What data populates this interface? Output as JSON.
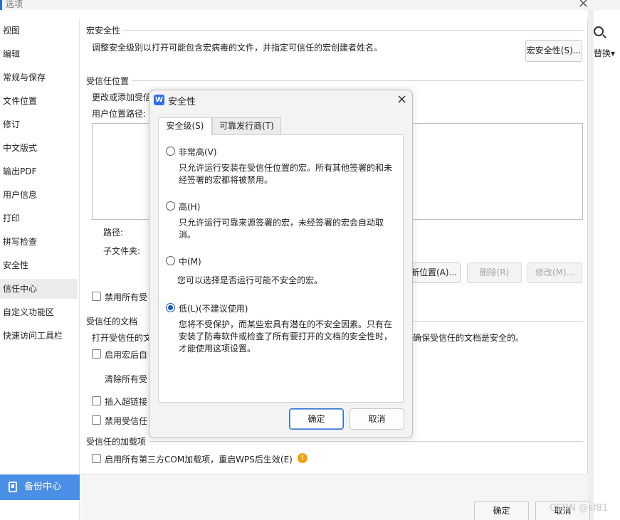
{
  "window": {
    "title": "选项",
    "close_glyph": "×"
  },
  "sidebar": {
    "items": [
      {
        "label": "视图"
      },
      {
        "label": "编辑"
      },
      {
        "label": "常规与保存"
      },
      {
        "label": "文件位置"
      },
      {
        "label": "修订"
      },
      {
        "label": "中文版式"
      },
      {
        "label": "输出PDF"
      },
      {
        "label": "用户信息"
      },
      {
        "label": "打印"
      },
      {
        "label": "拼写检查"
      },
      {
        "label": "安全性"
      },
      {
        "label": "信任中心"
      },
      {
        "label": "自定义功能区"
      },
      {
        "label": "快速访问工具栏"
      }
    ],
    "active_index": 11,
    "backup_label": "备份中心"
  },
  "right_edge": {
    "replace_label": "替换▾"
  },
  "macro_security": {
    "title": "宏安全性",
    "description": "调整安全级别以打开可能包含宏病毒的文件，并指定可信任的宏创建者姓名。",
    "button_label": "宏安全性(S)..."
  },
  "trusted_locations": {
    "title": "受信任位置",
    "description_partial": "更改或添加受信",
    "user_path_label": "用户位置路径:",
    "path_label": "路径:",
    "subfolder_label": "子文件夹:",
    "add_button_partial": "新位置(A)...",
    "delete_button": "删除(R)",
    "modify_button": "修改(M)...",
    "disable_all_partial": "禁用所有受"
  },
  "trusted_documents": {
    "title": "受信任的文档",
    "description_left": "打开受信任的文",
    "description_right": "确保受信任的文档是安全的。",
    "enable_macro_partial": "启用宏后自",
    "clear_partial": "清除所有受",
    "insert_hyperlink_partial": "插入超链接",
    "disable_trusted_partial": "禁用受信任"
  },
  "trusted_addins": {
    "title": "受信任的加载项",
    "enable_com_label": "启用所有第三方COM加载项，重启WPS后生效(E)",
    "warn_glyph": "!"
  },
  "bottom": {
    "ok_label": "确定",
    "cancel_label": "取消"
  },
  "dialog": {
    "logo_glyph": "W",
    "title": "安全性",
    "close_glyph": "×",
    "tabs": [
      {
        "label": "安全级(S)"
      },
      {
        "label": "可靠发行商(T)"
      }
    ],
    "active_tab": 0,
    "options": [
      {
        "label": "非常高(V)",
        "desc1": "只允许运行安装在受信任位置的宏。所有其他签署的和未",
        "desc2": "经签署的宏都将被禁用。"
      },
      {
        "label": "高(H)",
        "desc1": "只允许运行可靠来源签署的宏，未经签署的宏会自动取",
        "desc2": "消。"
      },
      {
        "label": "中(M)",
        "desc1": "您可以选择是否运行可能不安全的宏。",
        "desc2": ""
      },
      {
        "label": "低(L)(不建议使用)",
        "desc1": "您将不受保护，而某些宏具有潜在的不安全因素。只有在",
        "desc2": "安装了防毒软件或检查了所有要打开的文档的安全性时，",
        "desc3": "才能使用这项设置。"
      }
    ],
    "selected_option": 3,
    "ok_label": "确定",
    "cancel_label": "取消"
  },
  "watermark": "CSDN @sf81",
  "colors": {
    "accent": "#2f6ee5",
    "backup_bg": "#4a8fe6",
    "radio_checked": "#0f5dc2",
    "warning": "#f0a30a"
  }
}
